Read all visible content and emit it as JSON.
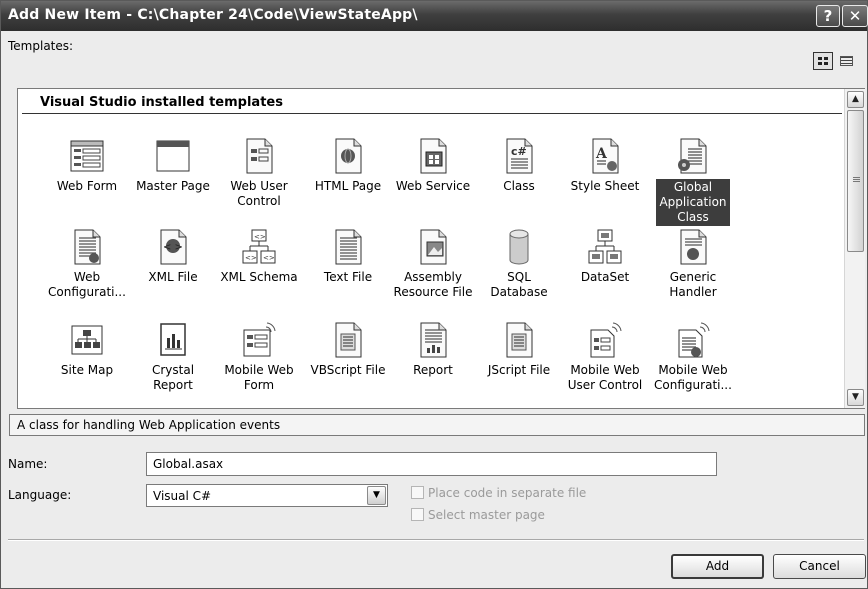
{
  "window": {
    "title": "Add New Item - C:\\Chapter 24\\Code\\ViewStateApp\\",
    "help_glyph": "?",
    "close_glyph": "✕"
  },
  "templates_label": "Templates:",
  "view_modes": [
    "large-icons",
    "small-icons"
  ],
  "group_header": "Visual Studio installed templates",
  "templates": [
    {
      "l1": "Web Form",
      "l2": "",
      "icon": "web-form-icon"
    },
    {
      "l1": "Master Page",
      "l2": "",
      "icon": "master-page-icon"
    },
    {
      "l1": "Web User",
      "l2": "Control",
      "icon": "web-user-control-icon"
    },
    {
      "l1": "HTML Page",
      "l2": "",
      "icon": "html-page-icon"
    },
    {
      "l1": "Web Service",
      "l2": "",
      "icon": "web-service-icon"
    },
    {
      "l1": "Class",
      "l2": "",
      "icon": "class-icon"
    },
    {
      "l1": "Style Sheet",
      "l2": "",
      "icon": "style-sheet-icon"
    },
    {
      "l1": "Global",
      "l2": "Application",
      "l3": "Class",
      "icon": "global-application-class-icon",
      "selected": true
    },
    {
      "l1": "Web",
      "l2": "Configurati...",
      "icon": "web-configuration-icon"
    },
    {
      "l1": "XML File",
      "l2": "",
      "icon": "xml-file-icon"
    },
    {
      "l1": "XML Schema",
      "l2": "",
      "icon": "xml-schema-icon"
    },
    {
      "l1": "Text File",
      "l2": "",
      "icon": "text-file-icon"
    },
    {
      "l1": "Assembly",
      "l2": "Resource File",
      "icon": "assembly-resource-file-icon"
    },
    {
      "l1": "SQL Database",
      "l2": "",
      "icon": "sql-database-icon"
    },
    {
      "l1": "DataSet",
      "l2": "",
      "icon": "dataset-icon"
    },
    {
      "l1": "Generic",
      "l2": "Handler",
      "icon": "generic-handler-icon"
    },
    {
      "l1": "Site Map",
      "l2": "",
      "icon": "site-map-icon"
    },
    {
      "l1": "Crystal Report",
      "l2": "",
      "icon": "crystal-report-icon"
    },
    {
      "l1": "Mobile Web",
      "l2": "Form",
      "icon": "mobile-web-form-icon"
    },
    {
      "l1": "VBScript File",
      "l2": "",
      "icon": "vbscript-file-icon"
    },
    {
      "l1": "Report",
      "l2": "",
      "icon": "report-icon"
    },
    {
      "l1": "JScript File",
      "l2": "",
      "icon": "jscript-file-icon"
    },
    {
      "l1": "Mobile Web",
      "l2": "User Control",
      "icon": "mobile-web-user-control-icon"
    },
    {
      "l1": "Mobile Web",
      "l2": "Configurati...",
      "icon": "mobile-web-configuration-icon"
    }
  ],
  "description": "A class for handling Web Application events",
  "name": {
    "label": "Name:",
    "value": "Global.asax"
  },
  "language": {
    "label": "Language:",
    "value": "Visual C#"
  },
  "options": {
    "place_code": "Place code in separate file",
    "master_page": "Select master page"
  },
  "buttons": {
    "add": "Add",
    "cancel": "Cancel"
  }
}
